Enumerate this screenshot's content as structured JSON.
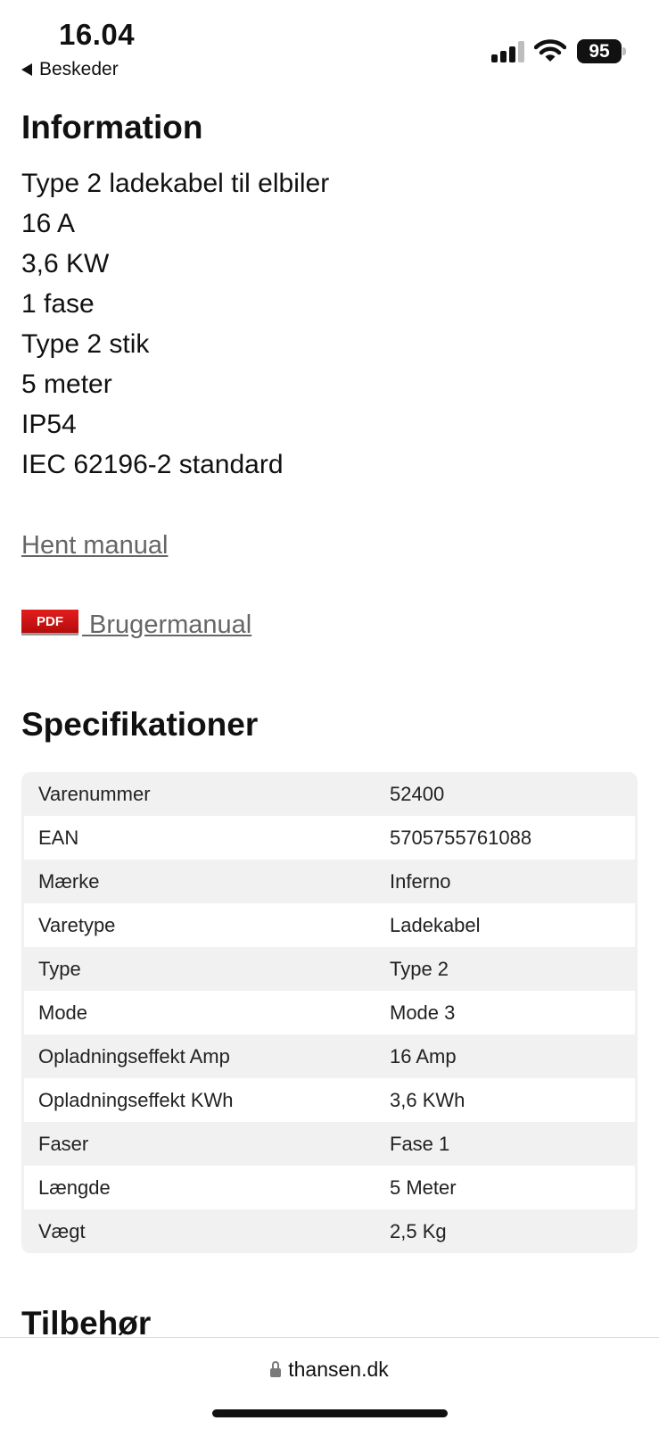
{
  "status_bar": {
    "time": "16.04",
    "back_label": "Beskeder",
    "battery_level": "95",
    "icons": [
      "signal-icon",
      "wifi-icon",
      "battery-icon"
    ]
  },
  "information": {
    "heading": "Information",
    "lines": [
      "Type 2 ladekabel til elbiler",
      "16 A",
      "3,6 KW",
      "1 fase",
      "Type 2 stik",
      "5 meter",
      "IP54",
      "IEC 62196-2 standard"
    ],
    "manual_link": "Hent manual",
    "pdf_badge": "PDF",
    "pdf_link": " Brugermanual"
  },
  "specifications": {
    "heading": "Specifikationer",
    "rows": [
      {
        "key": "Varenummer",
        "value": "52400"
      },
      {
        "key": "EAN",
        "value": "5705755761088"
      },
      {
        "key": "Mærke",
        "value": "Inferno"
      },
      {
        "key": "Varetype",
        "value": "Ladekabel"
      },
      {
        "key": "Type",
        "value": "Type 2"
      },
      {
        "key": "Mode",
        "value": "Mode 3"
      },
      {
        "key": "Opladningseffekt Amp",
        "value": "16 Amp"
      },
      {
        "key": "Opladningseffekt KWh",
        "value": "3,6 KWh"
      },
      {
        "key": "Faser",
        "value": "Fase 1"
      },
      {
        "key": "Længde",
        "value": "5 Meter"
      },
      {
        "key": "Vægt",
        "value": "2,5 Kg"
      }
    ]
  },
  "accessories": {
    "heading": "Tilbehør"
  },
  "browser": {
    "url": "thansen.dk"
  }
}
